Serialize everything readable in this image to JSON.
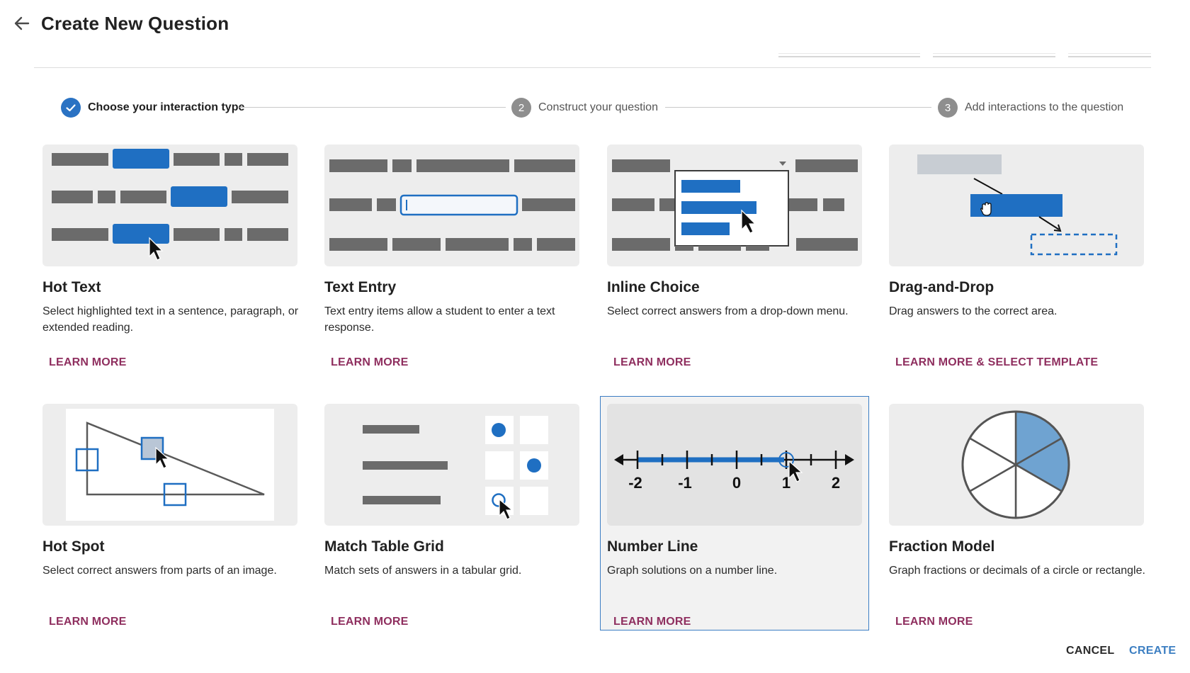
{
  "header": {
    "title": "Create New Question",
    "back_icon": "arrow-left-icon"
  },
  "stepper": {
    "steps": [
      {
        "number": "1",
        "label": "Choose your interaction type",
        "status": "complete"
      },
      {
        "number": "2",
        "label": "Construct your question",
        "status": "pending"
      },
      {
        "number": "3",
        "label": "Add interactions to the question",
        "status": "pending"
      }
    ]
  },
  "cards": [
    {
      "title": "Hot Text",
      "description": "Select highlighted text in a sentence, paragraph, or extended reading.",
      "link": "LEARN MORE"
    },
    {
      "title": "Text Entry",
      "description": "Text entry items allow a student to enter a text response.",
      "link": "LEARN MORE"
    },
    {
      "title": "Inline Choice",
      "description": "Select correct answers from a drop-down menu.",
      "link": "LEARN MORE"
    },
    {
      "title": "Drag-and-Drop",
      "description": "Drag answers to the correct area.",
      "link": "LEARN MORE & SELECT TEMPLATE"
    },
    {
      "title": "Hot Spot",
      "description": "Select correct answers from parts of an image.",
      "link": "LEARN MORE"
    },
    {
      "title": "Match Table Grid",
      "description": "Match sets of answers in a tabular grid.",
      "link": "LEARN MORE"
    },
    {
      "title": "Number Line",
      "description": "Graph solutions on a number line.",
      "link": "LEARN MORE",
      "selected": true
    },
    {
      "title": "Fraction Model",
      "description": "Graph fractions or decimals of a circle or rectangle.",
      "link": "LEARN MORE"
    }
  ],
  "number_line_ticks": [
    "-2",
    "-1",
    "0",
    "1",
    "2"
  ],
  "footer": {
    "cancel": "CANCEL",
    "create": "CREATE"
  },
  "colors": {
    "accent_blue": "#1f6fc2",
    "link_color": "#8f2f5f",
    "create_blue": "#3d7fc2",
    "step_complete": "#2a72c3",
    "bar_gray": "#6b6b6b"
  }
}
